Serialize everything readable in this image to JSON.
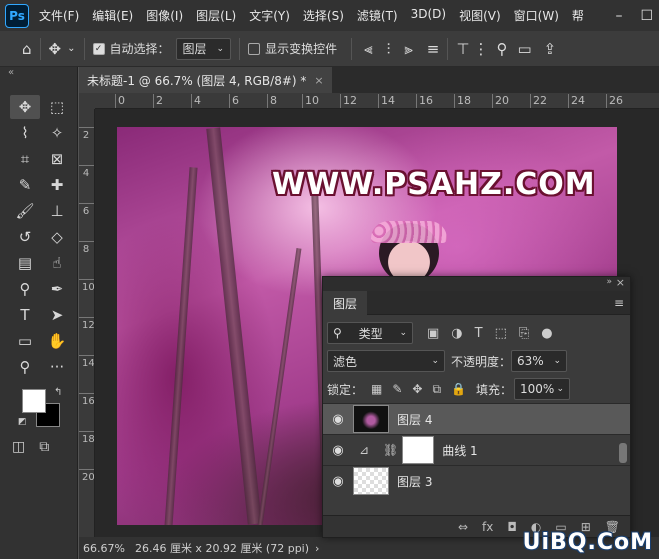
{
  "app": {
    "logo": "Ps",
    "menu": [
      "文件(F)",
      "编辑(E)",
      "图像(I)",
      "图层(L)",
      "文字(Y)",
      "选择(S)",
      "滤镜(T)",
      "3D(D)",
      "视图(V)",
      "窗口(W)",
      "帮"
    ],
    "win_controls": [
      "–",
      "☐"
    ]
  },
  "options": {
    "auto_select_label": "自动选择：",
    "auto_select_target": "图层",
    "transform_label": "显示变换控件"
  },
  "toolbar": {
    "collapse": "«",
    "tools": [
      {
        "icon": "move-icon",
        "glyph": "✥"
      },
      {
        "icon": "marquee-icon",
        "glyph": "⬚"
      },
      {
        "icon": "lasso-icon",
        "glyph": "⌇"
      },
      {
        "icon": "magic-wand-icon",
        "glyph": "✧"
      },
      {
        "icon": "crop-icon",
        "glyph": "⌗"
      },
      {
        "icon": "frame-icon",
        "glyph": "⊠"
      },
      {
        "icon": "eyedropper-icon",
        "glyph": "✎"
      },
      {
        "icon": "healing-icon",
        "glyph": "✚"
      },
      {
        "icon": "brush-icon",
        "glyph": "🖌"
      },
      {
        "icon": "stamp-icon",
        "glyph": "⊥"
      },
      {
        "icon": "history-brush-icon",
        "glyph": "↺"
      },
      {
        "icon": "eraser-icon",
        "glyph": "◇"
      },
      {
        "icon": "gradient-icon",
        "glyph": "▤"
      },
      {
        "icon": "smudge-icon",
        "glyph": "☝"
      },
      {
        "icon": "dodge-icon",
        "glyph": "⚲"
      },
      {
        "icon": "pen-icon",
        "glyph": "✒"
      },
      {
        "icon": "type-icon",
        "glyph": "T"
      },
      {
        "icon": "path-select-icon",
        "glyph": "➤"
      },
      {
        "icon": "rectangle-icon",
        "glyph": "▭"
      },
      {
        "icon": "hand-icon",
        "glyph": "✋"
      },
      {
        "icon": "zoom-icon",
        "glyph": "⚲"
      },
      {
        "icon": "more-icon",
        "glyph": "···"
      }
    ]
  },
  "document": {
    "tab_title": "未标题-1 @ 66.7% (图层 4, RGB/8#) *",
    "close": "×",
    "ruler_h": [
      "0",
      "2",
      "4",
      "6",
      "8",
      "10",
      "12",
      "14",
      "16",
      "18",
      "20",
      "22",
      "24",
      "26"
    ],
    "ruler_v": [
      "2",
      "4",
      "6",
      "8",
      "10",
      "12",
      "14",
      "16",
      "18",
      "20"
    ],
    "canvas_text": "WWW.PSAHZ.COM"
  },
  "status": {
    "zoom": "66.67%",
    "size": "26.46 厘米 x 20.92 厘米 (72 ppi)",
    "arrow": "›"
  },
  "layers": {
    "title": "图层",
    "filter_kind": "类型",
    "blend_mode": "滤色",
    "opacity_label": "不透明度：",
    "opacity_value": "63%",
    "lock_label": "锁定：",
    "fill_label": "填充：",
    "fill_value": "100%",
    "items": [
      {
        "name": "图层 4",
        "selected": true
      },
      {
        "name": "曲线 1",
        "selected": false
      },
      {
        "name": "图层 3",
        "selected": false
      }
    ],
    "footer": [
      "⇔",
      "fx",
      "◘",
      "◐",
      "▭",
      "⊞",
      "🗑"
    ]
  },
  "watermark": "UiBQ.CoM"
}
